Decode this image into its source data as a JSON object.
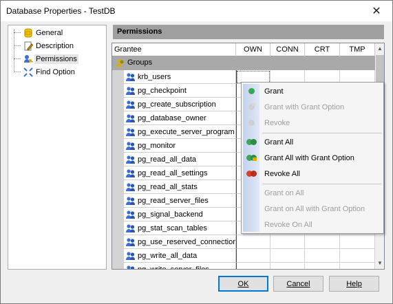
{
  "window": {
    "title": "Database Properties - TestDB"
  },
  "nav": {
    "items": [
      {
        "label": "General",
        "icon": "database-icon"
      },
      {
        "label": "Description",
        "icon": "document-edit-icon"
      },
      {
        "label": "Permissions",
        "icon": "key-user-icon",
        "selected": true
      },
      {
        "label": "Find Option",
        "icon": "find-arrows-icon"
      }
    ]
  },
  "panel": {
    "title": "Permissions"
  },
  "grid": {
    "columns": [
      "Grantee",
      "OWN",
      "CONN",
      "CRT",
      "TMP"
    ],
    "group_label": "Groups",
    "rows": [
      "krb_users",
      "pg_checkpoint",
      "pg_create_subscription",
      "pg_database_owner",
      "pg_execute_server_program",
      "pg_monitor",
      "pg_read_all_data",
      "pg_read_all_settings",
      "pg_read_all_stats",
      "pg_read_server_files",
      "pg_signal_backend",
      "pg_stat_scan_tables",
      "pg_use_reserved_connections",
      "pg_write_all_data",
      "pg_write_server_files"
    ]
  },
  "context_menu": {
    "items": [
      {
        "label": "Grant",
        "enabled": true,
        "icon": "green-dot-icon"
      },
      {
        "label": "Grant with Grant Option",
        "enabled": false,
        "icon": "grant-option-icon"
      },
      {
        "label": "Revoke",
        "enabled": false,
        "icon": "gray-dot-icon"
      },
      {
        "label": "Grant All",
        "enabled": true,
        "icon": "green-dots-icon"
      },
      {
        "label": "Grant All with Grant Option",
        "enabled": true,
        "icon": "grant-all-option-icon"
      },
      {
        "label": "Revoke All",
        "enabled": true,
        "icon": "red-dots-icon"
      },
      {
        "label": "Grant on All",
        "enabled": false
      },
      {
        "label": "Grant on All with Grant Option",
        "enabled": false
      },
      {
        "label": "Revoke On All",
        "enabled": false
      }
    ]
  },
  "buttons": {
    "ok": "OK",
    "cancel": "Cancel",
    "help": "Help"
  },
  "colors": {
    "accent": "#0078d7",
    "grant_green": "#3aa757",
    "revoke_red": "#d9412b",
    "header_gray": "#9f9f9f"
  }
}
